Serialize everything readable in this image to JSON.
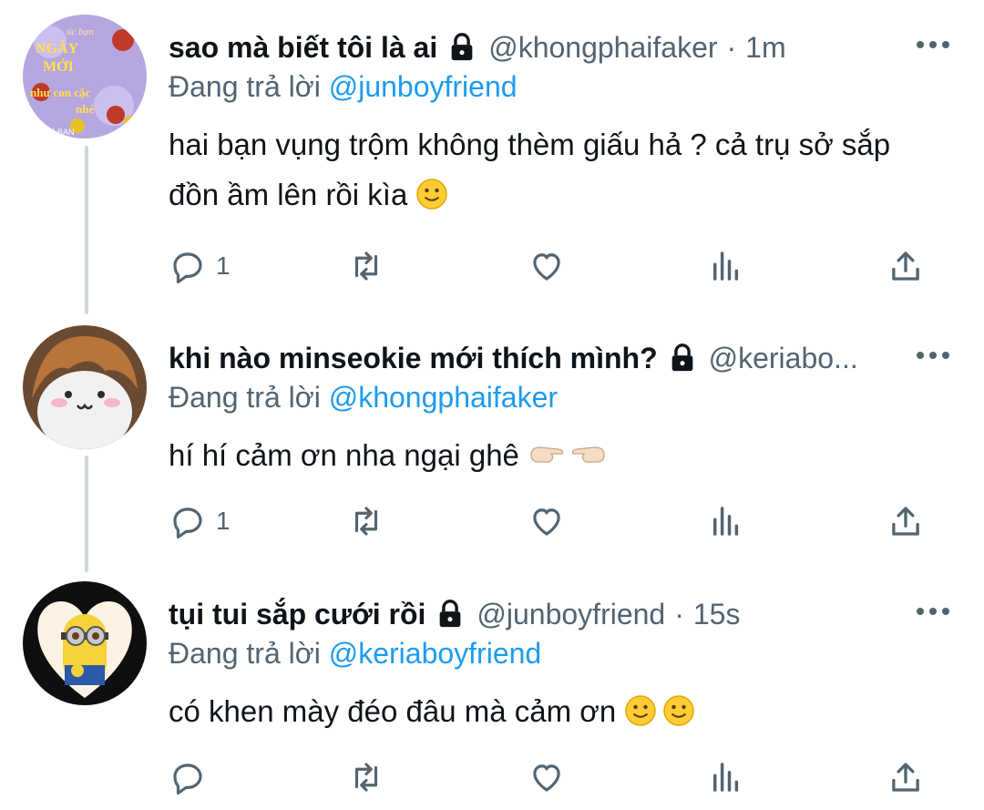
{
  "tweets": [
    {
      "display_name": "sao mà biết tôi là ai",
      "handle": "@khongphaifaker",
      "separator": "·",
      "time": "1m",
      "reply_prefix": "Đang trả lời",
      "reply_to": "@junboyfriend",
      "text": "hai bạn vụng trộm không thèm giấu hả ? cả trụ sở sắp đồn ầm lên rồi kìa",
      "emoji": [
        "slightly-smiling-face"
      ],
      "reply_count": "1",
      "avatar_text": {
        "l1": "úc bạn",
        "l2": "NGÀY",
        "l3": "MỚI",
        "l4": "như con cặc",
        "l5": "nhé",
        "l6": "ME BAN"
      }
    },
    {
      "display_name": "khi nào minseokie mới thích mình?",
      "handle": "@keriabo...",
      "reply_prefix": "Đang trả lời",
      "reply_to": "@khongphaifaker",
      "text": "hí hí cảm ơn nha ngại ghê",
      "emoji": [
        "pointing-fingers"
      ],
      "reply_count": "1"
    },
    {
      "display_name": "tụi tui sắp cưới rồi",
      "handle": "@junboyfriend",
      "separator": "·",
      "time": "15s",
      "reply_prefix": "Đang trả lời",
      "reply_to": "@keriaboyfriend",
      "text": "có khen mày đéo đâu mà cảm ơn",
      "emoji": [
        "slightly-smiling-face",
        "slightly-smiling-face"
      ],
      "reply_count": ""
    }
  ],
  "icons": [
    "lock-icon",
    "more-icon",
    "reply-icon",
    "retweet-icon",
    "like-icon",
    "views-icon",
    "share-icon"
  ],
  "colors": {
    "text": "#0f1419",
    "secondary": "#536471",
    "link": "#1d9bf0",
    "thread_line": "#cfd9de"
  }
}
